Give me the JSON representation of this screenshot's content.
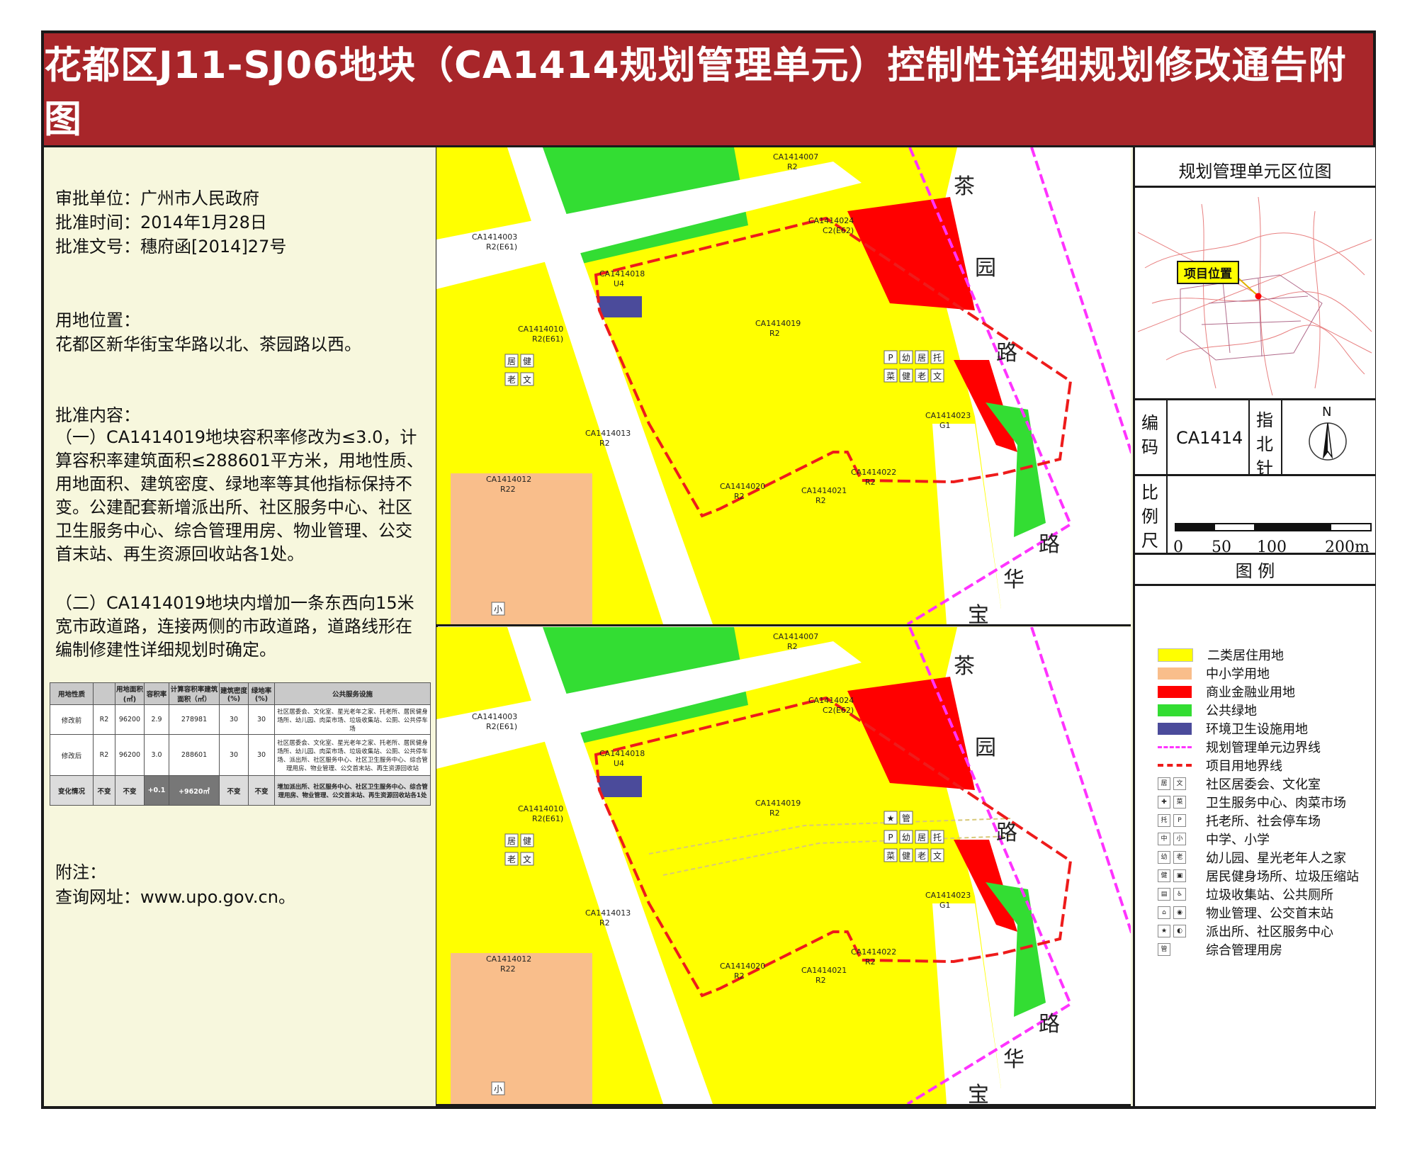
{
  "title": "花都区J11-SJ06地块（CA1414规划管理单元）控制性详细规划修改通告附图",
  "info": {
    "approval_unit": "审批单位：广州市人民政府",
    "approval_date": "批准时间：2014年1月28日",
    "approval_doc": "批准文号：穗府函[2014]27号",
    "location_label": "用地位置：",
    "location": "花都区新华街宝华路以北、茶园路以西。",
    "content_label": "批准内容：",
    "content_1": "（一）CA1414019地块容积率修改为≤3.0，计算容积率建筑面积≤288601平方米，用地性质、用地面积、建筑密度、绿地率等其他指标保持不变。公建配套新增派出所、社区服务中心、社区卫生服务中心、综合管理用房、物业管理、公交首末站、再生资源回收站各1处。",
    "content_2": "（二）CA1414019地块内增加一条东西向15米宽市政道路，连接两侧的市政道路，道路线形在编制修建性详细规划时确定。",
    "note_label": "附注：",
    "url": "查询网址：www.upo.gov.cn。"
  },
  "table": {
    "headers": [
      "用地性质",
      "用地面积(㎡)",
      "容积率",
      "计算容积率建筑面积（㎡）",
      "建筑密度(%)",
      "绿地率(%)",
      "公共服务设施"
    ],
    "rows": [
      {
        "label": "修改前",
        "cells": [
          "R2",
          "96200",
          "2.9",
          "278981",
          "30",
          "30"
        ],
        "facilities": "社区居委会、文化室、星光老年之家、托老所、居民健身场所、幼儿园、肉菜市场、垃圾收集站、公厕、公共停车场"
      },
      {
        "label": "修改后",
        "cells": [
          "R2",
          "96200",
          "3.0",
          "288601",
          "30",
          "30"
        ],
        "facilities": "社区居委会、文化室、星光老年之家、托老所、居民健身场所、幼儿园、肉菜市场、垃圾收集站、公厕、公共停车场、派出所、社区服务中心、社区卫生服务中心、综合管理用房、物业管理、公交首末站、再生资源回收站"
      },
      {
        "label": "变化情况",
        "cells": [
          "不变",
          "不变",
          "+0.1",
          "+9620㎡",
          "不变",
          "不变"
        ],
        "facilities": "增加派出所、社区服务中心、社区卫生服务中心、综合管理用房、物业管理、公交首末站、再生资源回收站各1处"
      }
    ]
  },
  "map": {
    "roads": {
      "chayuan": [
        "茶",
        "园",
        "路"
      ],
      "baohua": [
        "宝",
        "华",
        "路"
      ]
    },
    "parcels": [
      {
        "code": "CA1414007",
        "use": "R2"
      },
      {
        "code": "CA1414003",
        "use": "R2(E61)"
      },
      {
        "code": "CA1414018",
        "use": "U4"
      },
      {
        "code": "CA1414024",
        "use": "C2(E62)"
      },
      {
        "code": "CA1414019",
        "use": "R2"
      },
      {
        "code": "CA1414010",
        "use": "R2(E61)"
      },
      {
        "code": "CA1414023",
        "use": "G1"
      },
      {
        "code": "CA1414013",
        "use": "R2"
      },
      {
        "code": "CA1414012",
        "use": "R22"
      },
      {
        "code": "CA1414020",
        "use": "R2"
      },
      {
        "code": "CA1414021",
        "use": "R2"
      },
      {
        "code": "CA1414022",
        "use": "R2"
      }
    ],
    "facility_icons_019": [
      "P",
      "幼",
      "居",
      "托",
      "菜",
      "健",
      "老",
      "文"
    ],
    "facility_icons_010": [
      "居",
      "健",
      "老",
      "文"
    ],
    "facility_icons_new": [
      "★",
      "管"
    ],
    "school_icon": "小"
  },
  "right": {
    "location_map_title": "规划管理单元区位图",
    "project_location": "项目位置",
    "code_label": "编码",
    "code_value": "CA1414",
    "north_label": "指北针",
    "north_letter": "N",
    "scale_label": "比例尺",
    "scale_ticks": [
      "0",
      "50",
      "100",
      "200m"
    ],
    "legend_title": "图  例",
    "legend": [
      {
        "label": "二类居住用地",
        "color": "#ffff00"
      },
      {
        "label": "中小学用地",
        "color": "#f9be8b"
      },
      {
        "label": "商业金融业用地",
        "color": "#ff0000"
      },
      {
        "label": "公共绿地",
        "color": "#33dd33"
      },
      {
        "label": "环境卫生设施用地",
        "color": "#4b4b9b"
      },
      {
        "label": "规划管理单元边界线"
      },
      {
        "label": "项目用地界线"
      },
      {
        "label": "社区居委会、文化室"
      },
      {
        "label": "卫生服务中心、肉菜市场"
      },
      {
        "label": "托老所、社会停车场"
      },
      {
        "label": "中学、小学"
      },
      {
        "label": "幼儿园、星光老年人之家"
      },
      {
        "label": "居民健身场所、垃圾压缩站"
      },
      {
        "label": "垃圾收集站、公共厕所"
      },
      {
        "label": "物业管理、公交首末站"
      },
      {
        "label": "派出所、社区服务中心"
      },
      {
        "label": "综合管理用房"
      }
    ]
  }
}
